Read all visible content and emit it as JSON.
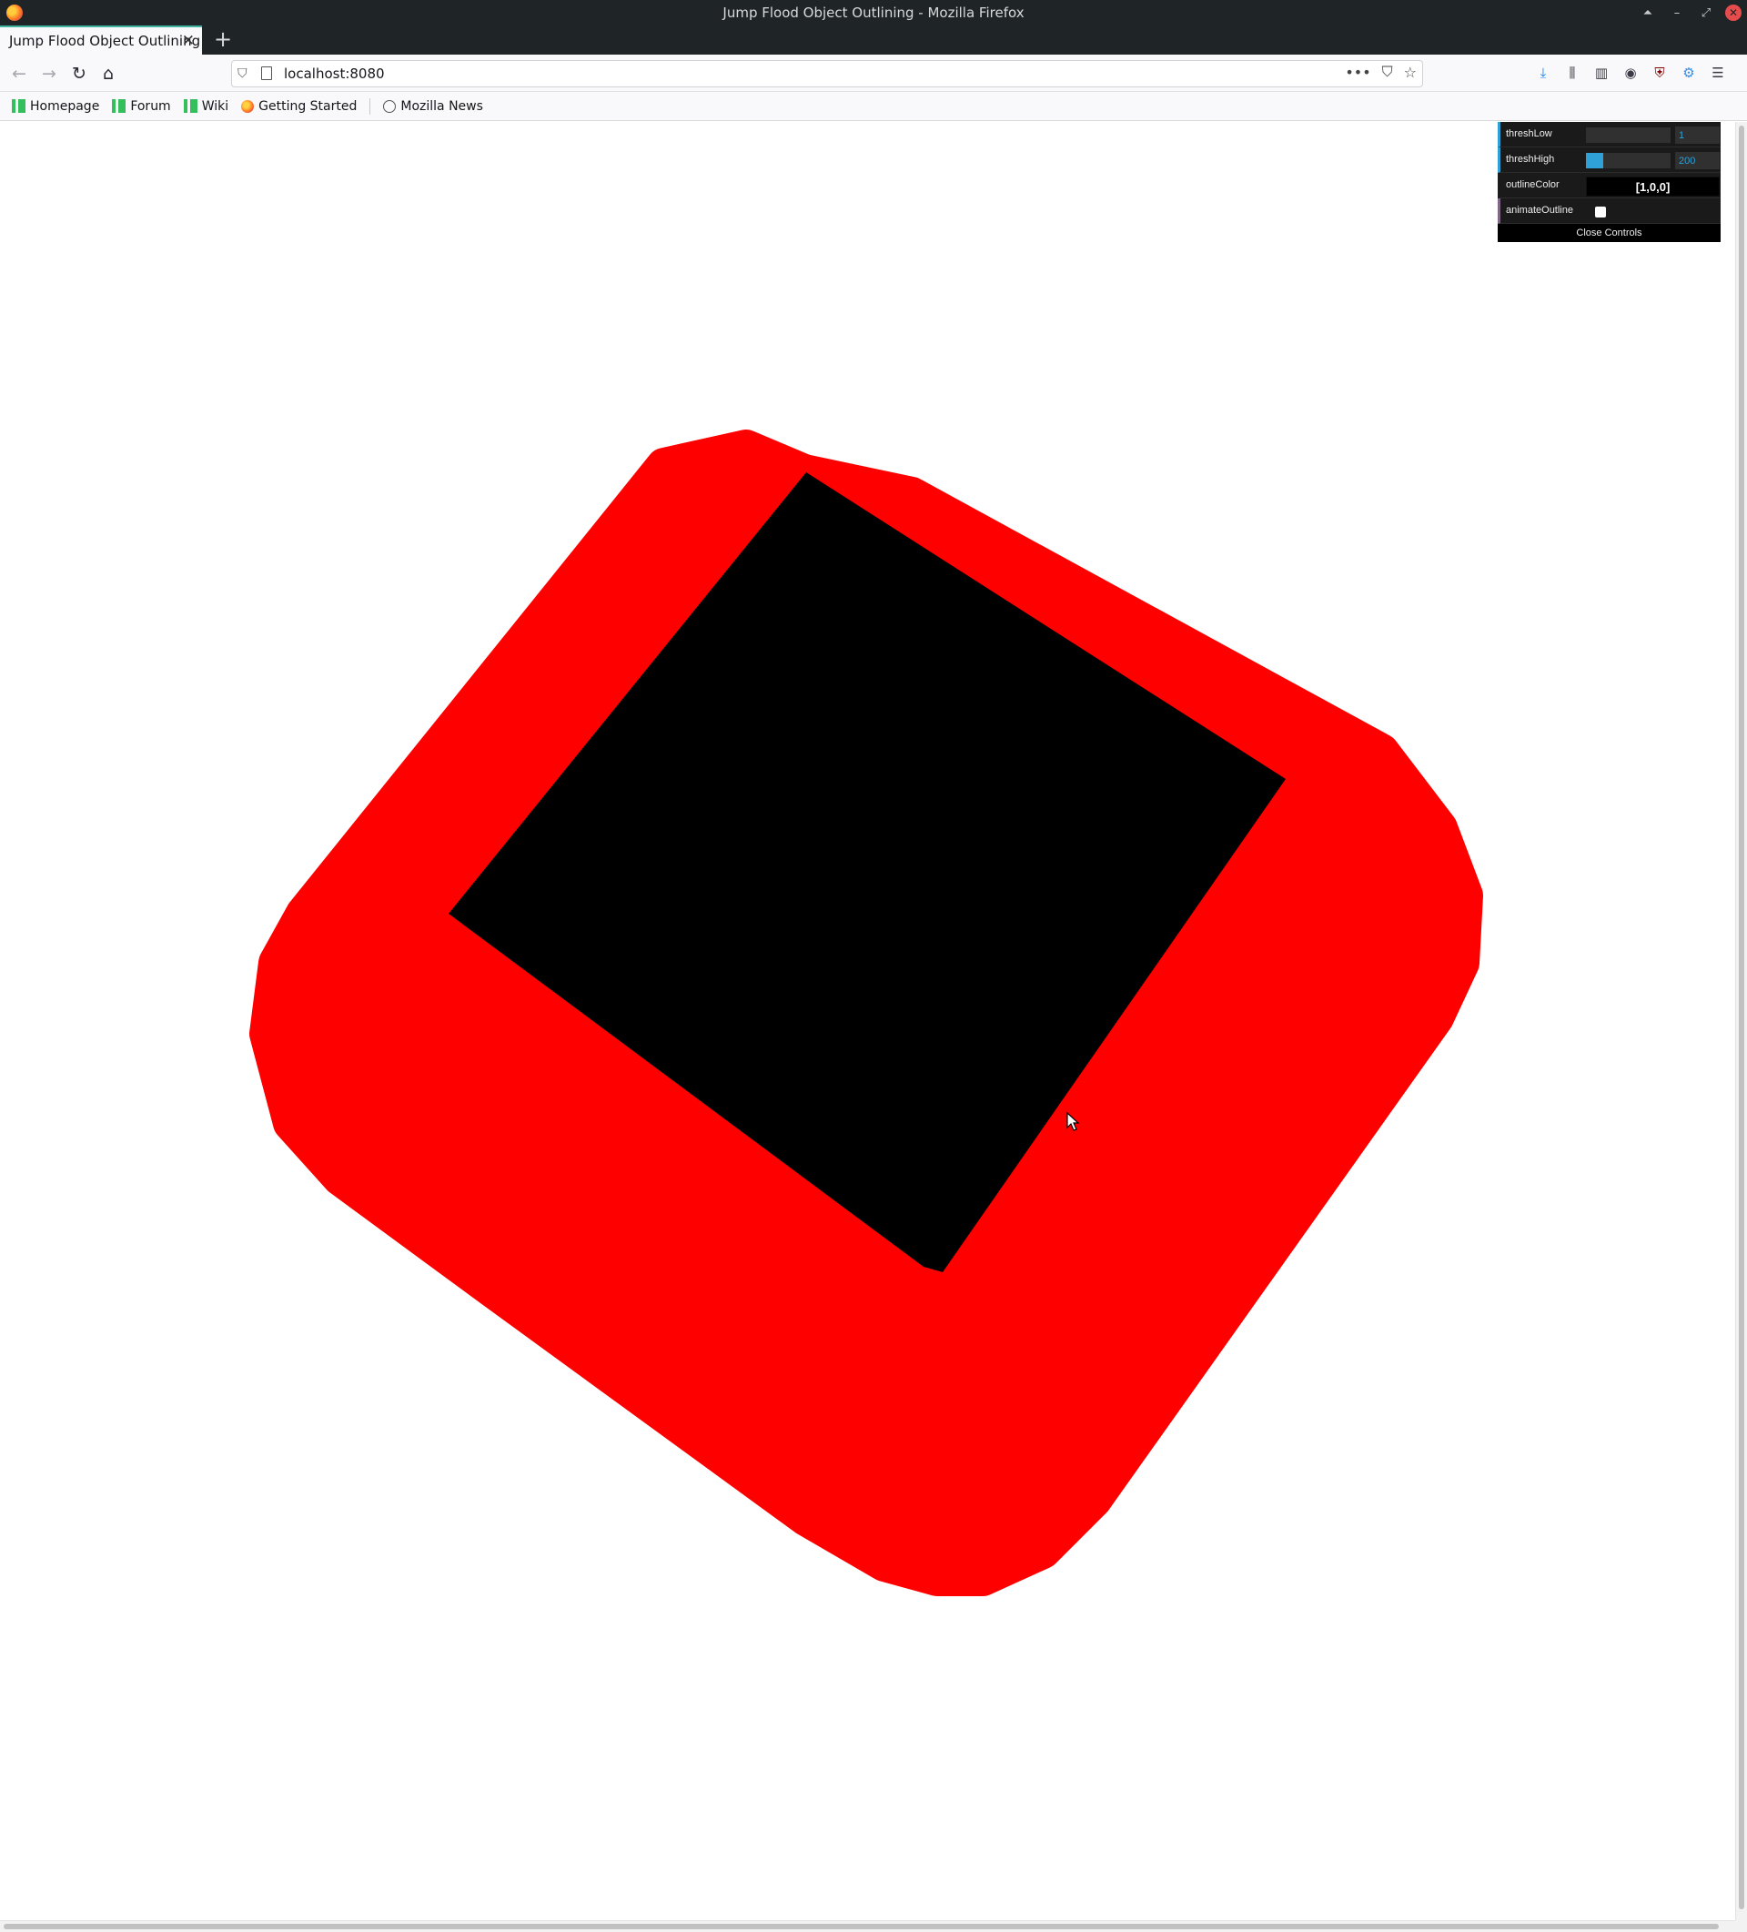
{
  "window": {
    "title": "Jump Flood Object Outlining - Mozilla Firefox",
    "controls": {
      "minimize": "–",
      "maximize": "⤢",
      "close": "✕",
      "extra": "⏶"
    }
  },
  "tab": {
    "title": "Jump Flood Object Outlining",
    "close": "✕",
    "new_tab": "+"
  },
  "nav": {
    "back": "←",
    "forward": "→",
    "reload": "↻",
    "home": "⌂",
    "url": "localhost:8080",
    "page_actions": "•••",
    "pocket": "⛉",
    "star": "☆",
    "toolbar": [
      "⤓",
      "⫼",
      "▥",
      "◉",
      "⛨",
      "⚙",
      "☰"
    ]
  },
  "bookmarks": [
    {
      "label": "Homepage",
      "icon": "manjaro-icon"
    },
    {
      "label": "Forum",
      "icon": "manjaro-icon"
    },
    {
      "label": "Wiki",
      "icon": "manjaro-icon"
    },
    {
      "label": "Getting Started",
      "icon": "firefox-icon"
    },
    {
      "label": "Mozilla News",
      "icon": "globe-icon"
    }
  ],
  "gui": {
    "thresh_low": {
      "label": "threshLow",
      "value": "1",
      "fraction": 0.0
    },
    "thresh_high": {
      "label": "threshHigh",
      "value": "200",
      "fraction": 0.2
    },
    "outline_color": {
      "label": "outlineColor",
      "value": "[1,0,0]"
    },
    "animate_outline": {
      "label": "animateOutline",
      "checked": false
    },
    "close_label": "Close Controls"
  },
  "scene": {
    "outline_color": "#ff0000",
    "object_color": "#000000"
  }
}
